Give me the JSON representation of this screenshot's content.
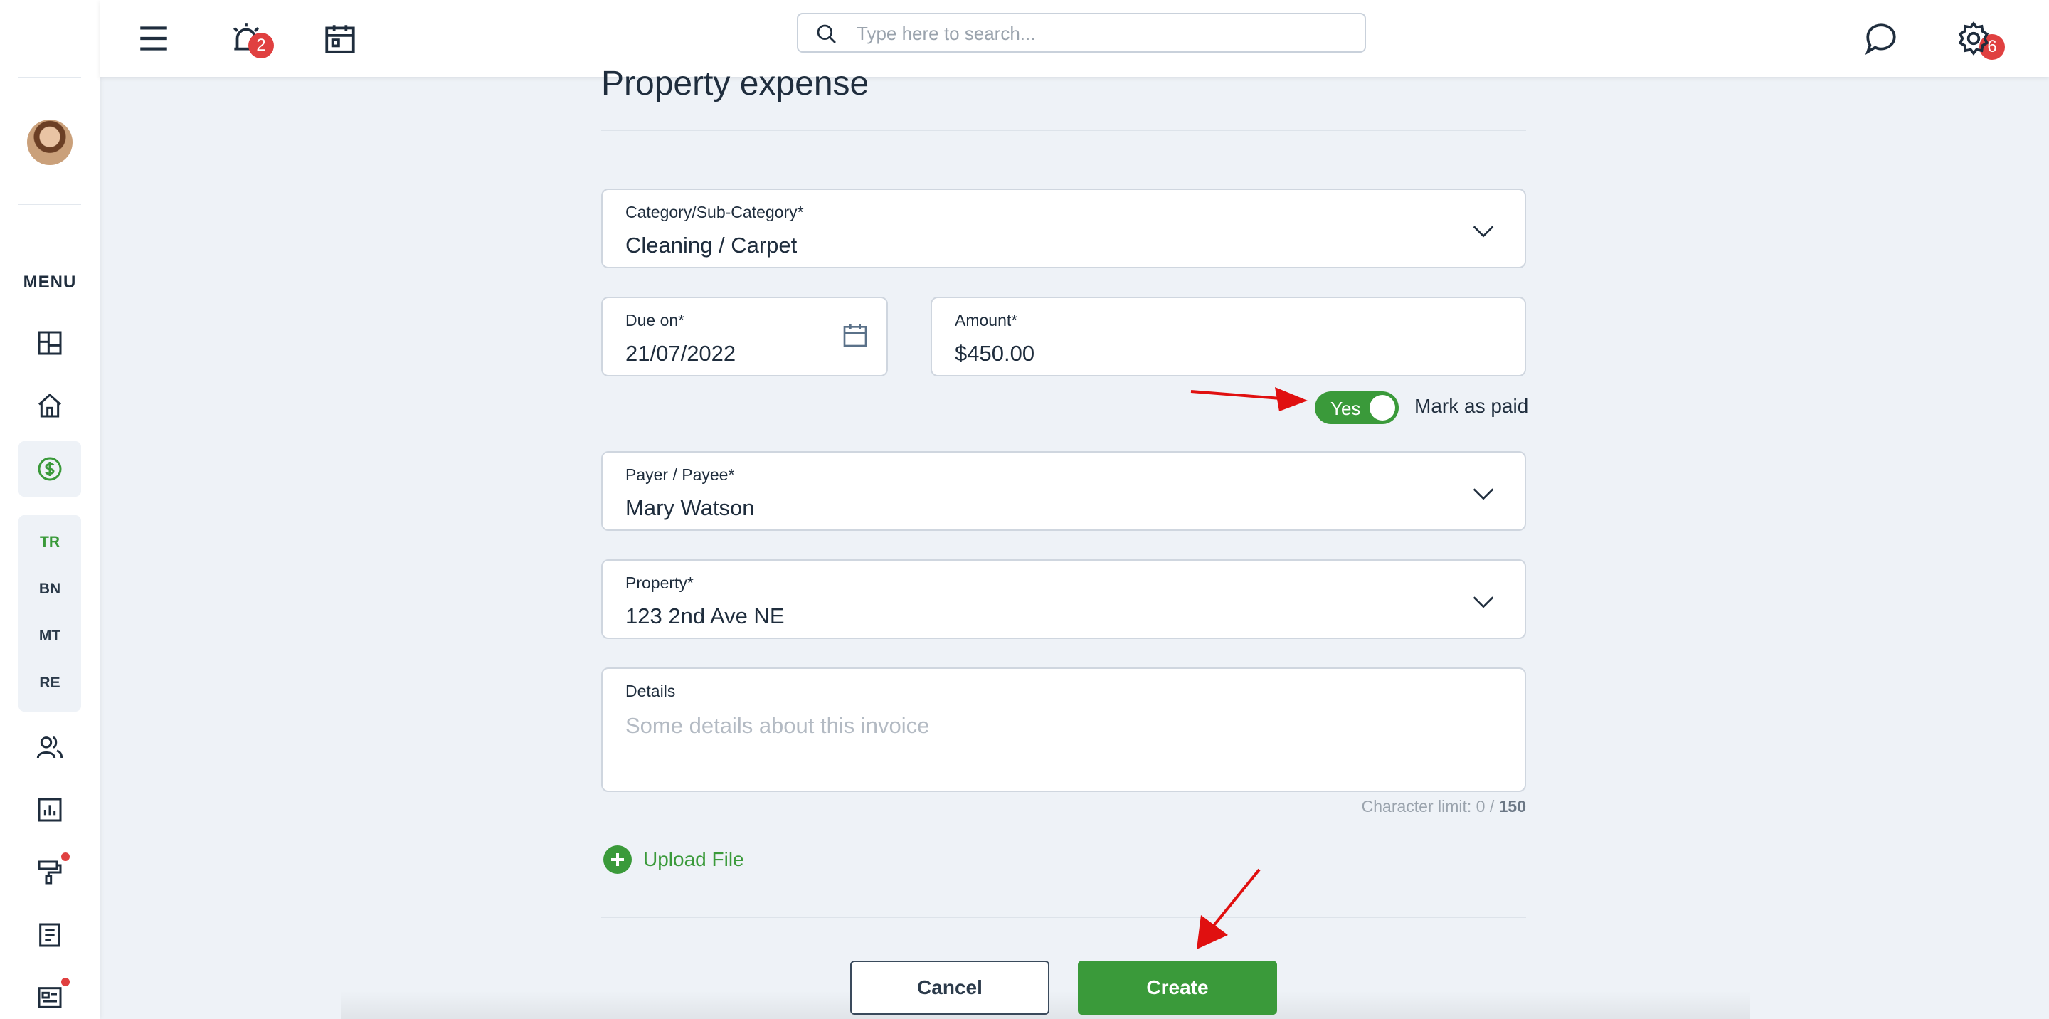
{
  "header": {
    "notification_count": "2",
    "message_count": "6",
    "search_placeholder": "Type here to search..."
  },
  "sidebar": {
    "menu_label": "MENU",
    "sub_items": [
      "TR",
      "BN",
      "MT",
      "RE"
    ]
  },
  "form": {
    "title": "Property expense",
    "category": {
      "label": "Category/Sub-Category*",
      "value": "Cleaning / Carpet"
    },
    "due_on": {
      "label": "Due on*",
      "value": "21/07/2022"
    },
    "amount": {
      "label": "Amount*",
      "value": "$450.00"
    },
    "mark_paid": {
      "toggle_text": "Yes",
      "label": "Mark as paid"
    },
    "payer": {
      "label": "Payer / Payee*",
      "value": "Mary Watson"
    },
    "property": {
      "label": "Property*",
      "value": "123 2nd Ave NE"
    },
    "details": {
      "label": "Details",
      "placeholder": "Some details about this invoice"
    },
    "char_limit": {
      "prefix": "Character limit: 0 / ",
      "max": "150"
    },
    "upload_label": "Upload File"
  },
  "buttons": {
    "cancel": "Cancel",
    "create": "Create"
  },
  "colors": {
    "accent": "#3a9a3a",
    "badge": "#e04040",
    "annotation_arrow": "#e01010"
  }
}
